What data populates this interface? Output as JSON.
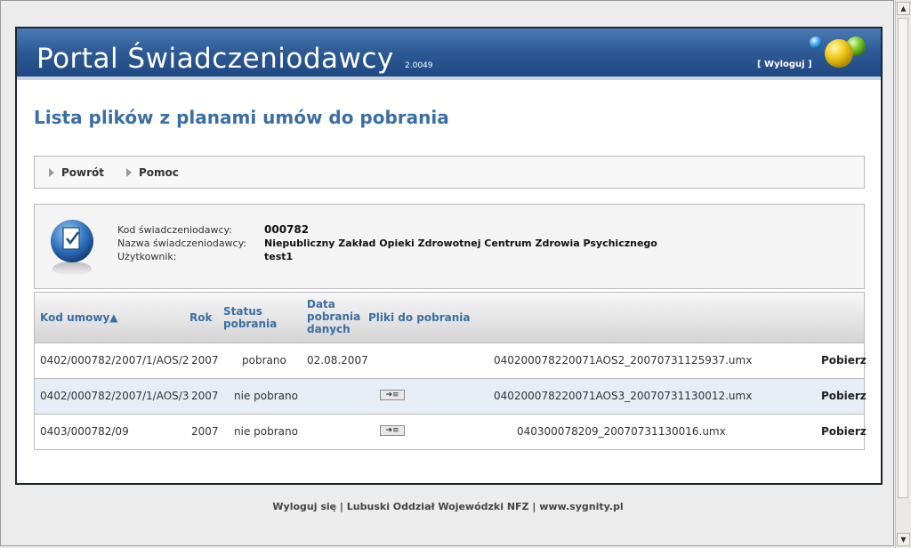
{
  "header": {
    "title": "Portal Świadczeniodawcy",
    "version": "2.0049",
    "logout": "[ Wyloguj ]"
  },
  "page": {
    "heading": "Lista plików z planami umów do pobrania"
  },
  "toolbar": {
    "back": "Powrót",
    "help": "Pomoc"
  },
  "info": {
    "code_label": "Kod świadczeniodawcy:",
    "code_value": "000782",
    "name_label": "Nazwa świadczeniodawcy:",
    "name_value": "Niepubliczny Zakład Opieki Zdrowotnej Centrum Zdrowia Psychicznego",
    "user_label": "Użytkownik:",
    "user_value": "test1"
  },
  "table": {
    "headers": {
      "code": "Kod umowy▲",
      "year": "Rok",
      "status": "Status pobrania",
      "date": "Data pobrania danych",
      "files": "Pliki do pobrania"
    },
    "rows": [
      {
        "code": "0402/000782/2007/1/AOS/2",
        "year": "2007",
        "status": "pobrano",
        "date": "02.08.2007",
        "file": "040200078220071AOS2_20070731125937.umx",
        "action": "Pobierz"
      },
      {
        "code": "0402/000782/2007/1/AOS/3",
        "year": "2007",
        "status": "nie pobrano",
        "date": "",
        "file": "040200078220071AOS3_20070731130012.umx",
        "action": "Pobierz"
      },
      {
        "code": "0403/000782/09",
        "year": "2007",
        "status": "nie pobrano",
        "date": "",
        "file": "040300078209_20070731130016.umx",
        "action": "Pobierz"
      }
    ]
  },
  "footer": {
    "text": "Wyloguj się | Lubuski Oddział Wojewódzki NFZ | www.sygnity.pl"
  },
  "colors": {
    "banner": "#2d5a95",
    "heading": "#3a6ea5",
    "alt_row": "#e6edf7"
  }
}
